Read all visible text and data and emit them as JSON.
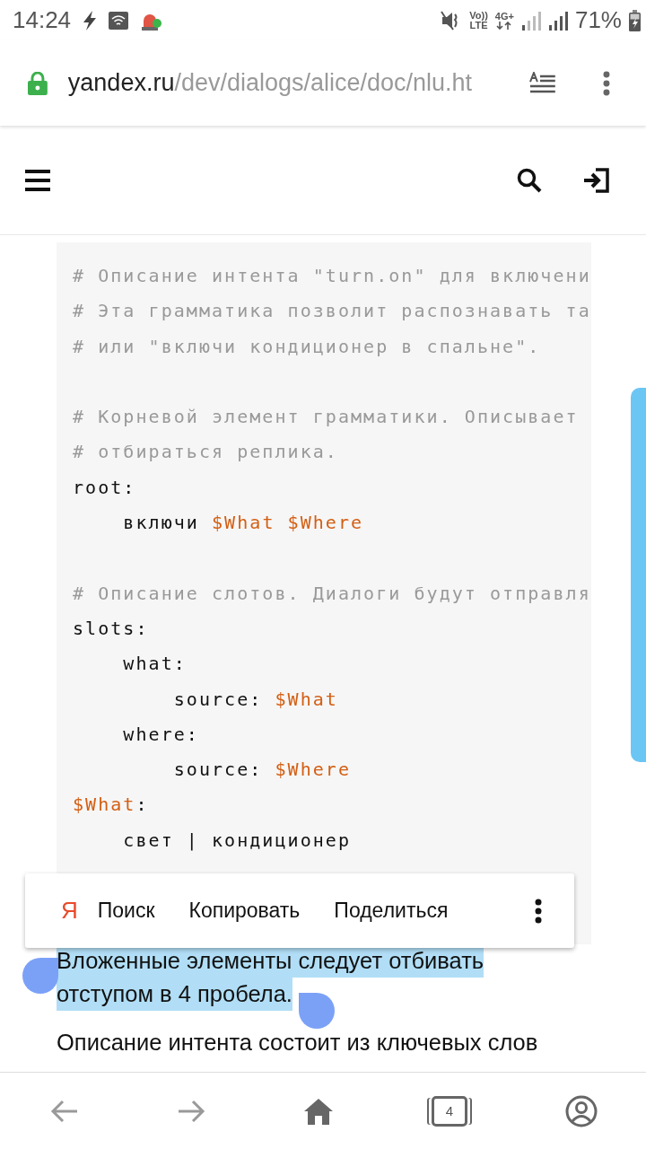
{
  "status_bar": {
    "time": "14:24",
    "volte": [
      "Vo))",
      "LTE"
    ],
    "network_type": "4G+",
    "battery": "71%"
  },
  "address_bar": {
    "domain": "yandex.ru",
    "path": "/dev/dialogs/alice/doc/nlu.ht"
  },
  "code_lines": [
    {
      "kind": "code",
      "segments": [
        {
          "kind": "comment",
          "text": "# Описание интента \"turn.on\" для включени"
        }
      ]
    },
    {
      "kind": "code",
      "segments": [
        {
          "kind": "comment",
          "text": "# Эта грамматика позволит распознавать та"
        }
      ]
    },
    {
      "kind": "code",
      "segments": [
        {
          "kind": "comment",
          "text": "# или \"включи кондиционер в спальне\"."
        }
      ]
    },
    {
      "kind": "blank"
    },
    {
      "kind": "code",
      "segments": [
        {
          "kind": "comment",
          "text": "# Корневой элемент грамматики. Описывает"
        }
      ]
    },
    {
      "kind": "code",
      "segments": [
        {
          "kind": "comment",
          "text": "# отбираться реплика."
        }
      ]
    },
    {
      "kind": "code",
      "segments": [
        {
          "kind": "plain",
          "text": "root:"
        }
      ]
    },
    {
      "kind": "code",
      "segments": [
        {
          "kind": "plain",
          "text": "    включи "
        },
        {
          "kind": "var",
          "text": "$What"
        },
        {
          "kind": "var",
          "text": " $Where"
        }
      ]
    },
    {
      "kind": "blank"
    },
    {
      "kind": "code",
      "segments": [
        {
          "kind": "comment",
          "text": "# Описание слотов. Диалоги будут отправля"
        }
      ]
    },
    {
      "kind": "code",
      "segments": [
        {
          "kind": "plain",
          "text": "slots:"
        }
      ]
    },
    {
      "kind": "code",
      "segments": [
        {
          "kind": "plain",
          "text": "    what:"
        }
      ]
    },
    {
      "kind": "code",
      "segments": [
        {
          "kind": "plain",
          "text": "        source: "
        },
        {
          "kind": "var",
          "text": "$What"
        }
      ]
    },
    {
      "kind": "code",
      "segments": [
        {
          "kind": "plain",
          "text": "    where:"
        }
      ]
    },
    {
      "kind": "code",
      "segments": [
        {
          "kind": "plain",
          "text": "        source: "
        },
        {
          "kind": "var",
          "text": "$Where"
        }
      ]
    },
    {
      "kind": "code",
      "segments": [
        {
          "kind": "var",
          "text": "$What"
        },
        {
          "kind": "plain",
          "text": ":"
        }
      ]
    },
    {
      "kind": "code",
      "segments": [
        {
          "kind": "plain",
          "text": "    свет | кондиционер"
        }
      ]
    }
  ],
  "selection_menu": {
    "logo": "Я",
    "items": [
      "Поиск",
      "Копировать",
      "Поделиться"
    ]
  },
  "paragraphs": [
    {
      "lines": [
        "Вложенные элементы следует отбивать",
        "отступом в 4 пробела."
      ],
      "selected": true
    },
    {
      "lines": [
        "Описание интента состоит из ключевых слов"
      ],
      "selected": false
    }
  ],
  "bottom_nav": {
    "tab_count": "4"
  }
}
